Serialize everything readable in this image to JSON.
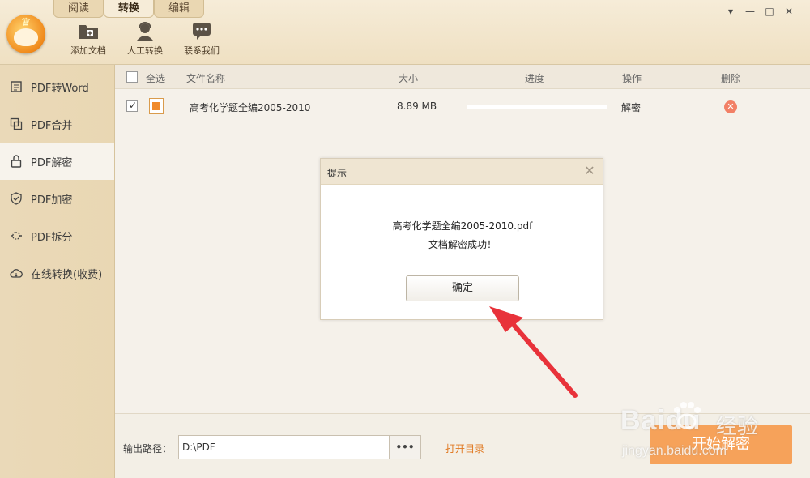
{
  "tabs": [
    {
      "label": "阅读"
    },
    {
      "label": "转换"
    },
    {
      "label": "编辑"
    }
  ],
  "toolbar": [
    {
      "label": "添加文档",
      "icon": "add-folder-icon"
    },
    {
      "label": "人工转换",
      "icon": "support-person-icon"
    },
    {
      "label": "联系我们",
      "icon": "chat-icon"
    }
  ],
  "window_controls": [
    "▾",
    "—",
    "□",
    "✕"
  ],
  "sidebar": {
    "items": [
      {
        "label": "PDF转Word",
        "icon": "word-doc-icon"
      },
      {
        "label": "PDF合并",
        "icon": "merge-icon"
      },
      {
        "label": "PDF解密",
        "icon": "unlock-icon"
      },
      {
        "label": "PDF加密",
        "icon": "shield-icon"
      },
      {
        "label": "PDF拆分",
        "icon": "split-icon"
      },
      {
        "label": "在线转换(收费)",
        "icon": "cloud-icon"
      }
    ],
    "active_index": 2
  },
  "table": {
    "headers": {
      "select_all": "全选",
      "filename": "文件名称",
      "size": "大小",
      "progress": "进度",
      "action": "操作",
      "delete": "删除"
    },
    "rows": [
      {
        "checked": true,
        "filename": "高考化学题全编2005-2010",
        "size": "8.89 MB",
        "progress": 0.0,
        "action": "解密"
      }
    ]
  },
  "bottom": {
    "output_label": "输出路径：",
    "output_path": "D:\\PDF",
    "browse_label": "•••",
    "open_dir_label": "打开目录",
    "start_label": "开始解密"
  },
  "dialog": {
    "title": "提示",
    "close_label": "✕",
    "line1": "高考化学题全编2005-2010.pdf",
    "line2": "文档解密成功！",
    "ok_label": "确定"
  },
  "watermark": {
    "main": "Baidu",
    "cn": "经验",
    "sub": "jingyan.baidu.com"
  },
  "colors": {
    "accent": "#f08a2b",
    "arrow": "#e8323a",
    "delete": "#f28066"
  }
}
